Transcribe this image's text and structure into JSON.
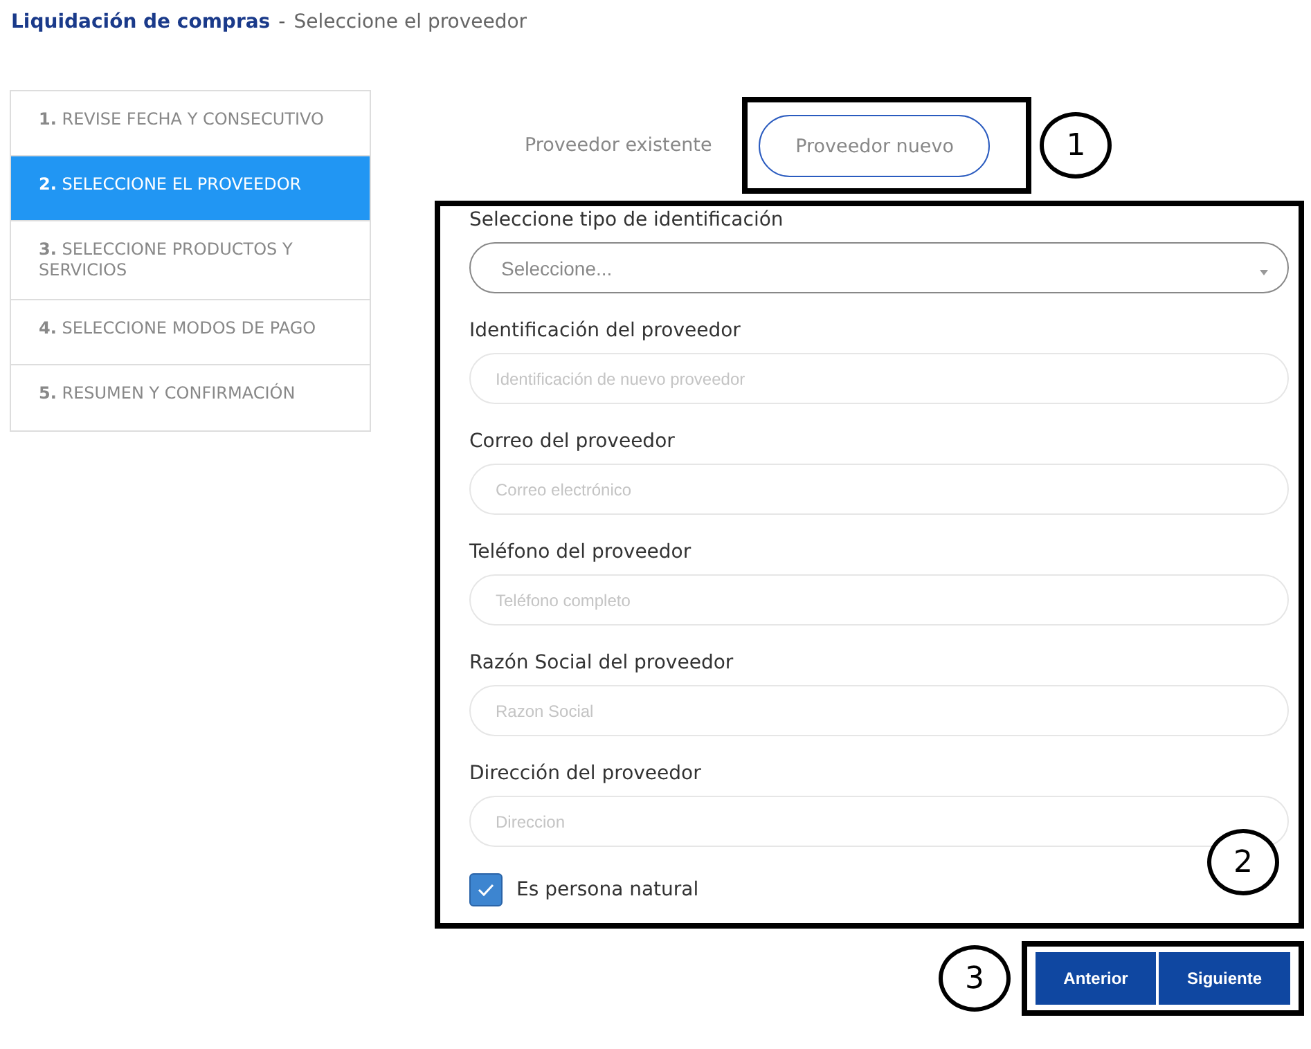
{
  "header": {
    "title": "Liquidación de compras",
    "separator": "-",
    "subtitle": "Seleccione el proveedor"
  },
  "steps": [
    {
      "number": "1.",
      "label": "REVISE FECHA Y CONSECUTIVO",
      "selected": false
    },
    {
      "number": "2.",
      "label": "SELECCIONE EL PROVEEDOR",
      "selected": true
    },
    {
      "number": "3.",
      "label": "SELECCIONE PRODUCTOS Y SERVICIOS",
      "selected": false
    },
    {
      "number": "4.",
      "label": "SELECCIONE MODOS DE PAGO",
      "selected": false
    },
    {
      "number": "5.",
      "label": "RESUMEN Y CONFIRMACIÓN",
      "selected": false
    }
  ],
  "provider_toggle": {
    "annotation": "1",
    "options": [
      {
        "label": "Proveedor existente",
        "selected": false
      },
      {
        "label": "Proveedor nuevo",
        "selected": true
      }
    ]
  },
  "form": {
    "annotation": "2",
    "fields": [
      {
        "kind": "select",
        "label": "Seleccione tipo de identificación",
        "placeholder": "Seleccione..."
      },
      {
        "kind": "input",
        "label": "Identificación del proveedor",
        "placeholder": "Identificación de nuevo proveedor"
      },
      {
        "kind": "input",
        "label": "Correo del proveedor",
        "placeholder": "Correo electrónico"
      },
      {
        "kind": "input",
        "label": "Teléfono del proveedor",
        "placeholder": "Teléfono completo"
      },
      {
        "kind": "input",
        "label": "Razón Social del proveedor",
        "placeholder": "Razon Social"
      },
      {
        "kind": "input",
        "label": "Dirección del proveedor",
        "placeholder": "Direccion"
      }
    ],
    "checkbox": {
      "label": "Es persona natural",
      "checked": true
    }
  },
  "navigation": {
    "annotation": "3",
    "buttons": [
      "Anterior",
      "Siguiente"
    ]
  }
}
